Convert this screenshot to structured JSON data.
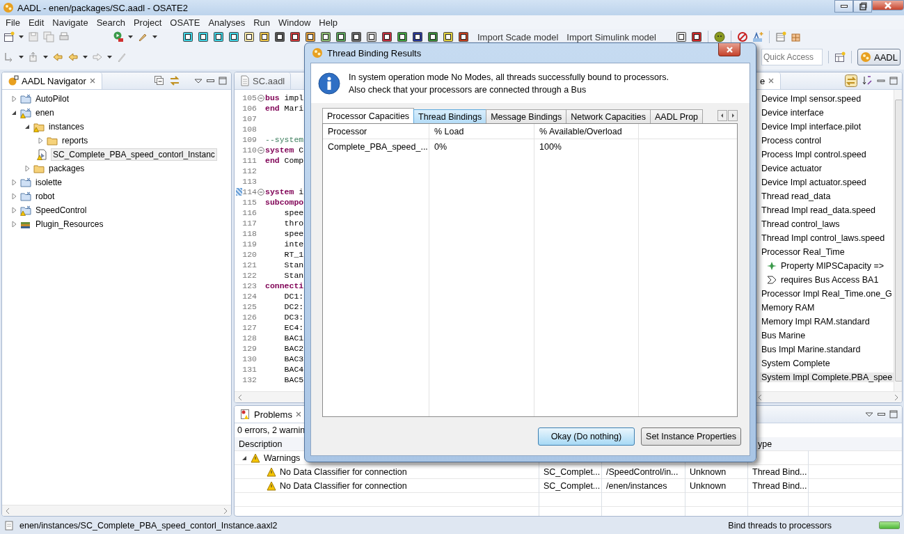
{
  "window": {
    "title": "AADL - enen/packages/SC.aadl - OSATE2"
  },
  "menu": [
    "File",
    "Edit",
    "Navigate",
    "Search",
    "Project",
    "OSATE",
    "Analyses",
    "Run",
    "Window",
    "Help"
  ],
  "toolbar": {
    "links": [
      "Import Scade model",
      "Import Simulink model"
    ],
    "quick_access": {
      "placeholder": "Quick Access"
    },
    "perspective": {
      "label": "AADL",
      "selected": true
    }
  },
  "navigator": {
    "title": "AADL Navigator",
    "items": [
      {
        "label": "AutoPilot",
        "kind": "project",
        "warning": false,
        "expanded": false,
        "selected": false
      },
      {
        "label": "enen",
        "kind": "project",
        "warning": true,
        "expanded": true,
        "selected": false,
        "children": [
          {
            "label": "instances",
            "kind": "folder",
            "warning": true,
            "expanded": true,
            "selected": false,
            "children": [
              {
                "label": "reports",
                "kind": "folder",
                "warning": false,
                "expanded": false,
                "selected": false
              },
              {
                "label": "SC_Complete_PBA_speed_contorl_Instanc",
                "kind": "file",
                "warning": true,
                "selected": true
              }
            ]
          },
          {
            "label": "packages",
            "kind": "folder",
            "warning": false,
            "expanded": false,
            "selected": false
          }
        ]
      },
      {
        "label": "isolette",
        "kind": "project",
        "warning": false,
        "expanded": false,
        "selected": false
      },
      {
        "label": "robot",
        "kind": "project",
        "warning": false,
        "expanded": false,
        "selected": false
      },
      {
        "label": "SpeedControl",
        "kind": "project",
        "warning": true,
        "expanded": false,
        "selected": false
      },
      {
        "label": "Plugin_Resources",
        "kind": "library",
        "warning": false,
        "expanded": false,
        "selected": false
      }
    ]
  },
  "editor": {
    "tab": "SC.aadl",
    "lines": [
      {
        "num": "105",
        "fold": true,
        "marked": false,
        "tokens": [
          {
            "kind": "keyword",
            "text": "bus"
          },
          {
            "kind": "plain",
            "text": " impl"
          }
        ]
      },
      {
        "num": "106",
        "fold": false,
        "marked": false,
        "tokens": [
          {
            "kind": "keyword",
            "text": "end"
          },
          {
            "kind": "plain",
            "text": " Mari"
          }
        ]
      },
      {
        "num": "107",
        "fold": false,
        "marked": false
      },
      {
        "num": "108",
        "fold": false,
        "marked": false
      },
      {
        "num": "109",
        "fold": false,
        "marked": false,
        "tokens": [
          {
            "kind": "comment",
            "text": "--system"
          }
        ]
      },
      {
        "num": "110",
        "fold": true,
        "marked": false,
        "tokens": [
          {
            "kind": "keyword",
            "text": "system"
          },
          {
            "kind": "plain",
            "text": " C"
          }
        ]
      },
      {
        "num": "111",
        "fold": false,
        "marked": false,
        "tokens": [
          {
            "kind": "keyword",
            "text": "end"
          },
          {
            "kind": "plain",
            "text": " Comp"
          }
        ]
      },
      {
        "num": "112",
        "fold": false,
        "marked": false
      },
      {
        "num": "113",
        "fold": false,
        "marked": false
      },
      {
        "num": "114",
        "fold": true,
        "marked": true,
        "tokens": [
          {
            "kind": "keyword",
            "text": "system"
          },
          {
            "kind": "plain",
            "text": " i"
          }
        ]
      },
      {
        "num": "115",
        "fold": false,
        "marked": false,
        "tokens": [
          {
            "kind": "keyword",
            "text": "subcompo"
          }
        ]
      },
      {
        "num": "116",
        "fold": false,
        "marked": false,
        "tokens": [
          {
            "kind": "plain",
            "text": "    spee"
          }
        ]
      },
      {
        "num": "117",
        "fold": false,
        "marked": false,
        "tokens": [
          {
            "kind": "plain",
            "text": "    thro"
          }
        ]
      },
      {
        "num": "118",
        "fold": false,
        "marked": false,
        "tokens": [
          {
            "kind": "plain",
            "text": "    spee"
          }
        ]
      },
      {
        "num": "119",
        "fold": false,
        "marked": false,
        "tokens": [
          {
            "kind": "plain",
            "text": "    inte"
          }
        ]
      },
      {
        "num": "120",
        "fold": false,
        "marked": false,
        "tokens": [
          {
            "kind": "plain",
            "text": "    RT_1"
          }
        ]
      },
      {
        "num": "121",
        "fold": false,
        "marked": false,
        "tokens": [
          {
            "kind": "plain",
            "text": "    Stan"
          }
        ]
      },
      {
        "num": "122",
        "fold": false,
        "marked": false,
        "tokens": [
          {
            "kind": "plain",
            "text": "    Stan"
          }
        ]
      },
      {
        "num": "123",
        "fold": false,
        "marked": false,
        "tokens": [
          {
            "kind": "keyword",
            "text": "connecti"
          }
        ]
      },
      {
        "num": "124",
        "fold": false,
        "marked": false,
        "tokens": [
          {
            "kind": "plain",
            "text": "    DC1:"
          }
        ]
      },
      {
        "num": "125",
        "fold": false,
        "marked": false,
        "tokens": [
          {
            "kind": "plain",
            "text": "    DC2:"
          }
        ]
      },
      {
        "num": "126",
        "fold": false,
        "marked": false,
        "tokens": [
          {
            "kind": "plain",
            "text": "    DC3:"
          }
        ]
      },
      {
        "num": "127",
        "fold": false,
        "marked": false,
        "tokens": [
          {
            "kind": "plain",
            "text": "    EC4:"
          }
        ]
      },
      {
        "num": "128",
        "fold": false,
        "marked": false,
        "tokens": [
          {
            "kind": "plain",
            "text": "    BAC1"
          }
        ]
      },
      {
        "num": "129",
        "fold": false,
        "marked": false,
        "tokens": [
          {
            "kind": "plain",
            "text": "    BAC2"
          }
        ]
      },
      {
        "num": "130",
        "fold": false,
        "marked": false,
        "tokens": [
          {
            "kind": "plain",
            "text": "    BAC3"
          }
        ]
      },
      {
        "num": "131",
        "fold": false,
        "marked": false,
        "tokens": [
          {
            "kind": "plain",
            "text": "    BAC4"
          }
        ]
      },
      {
        "num": "132",
        "fold": false,
        "marked": false,
        "tokens": [
          {
            "kind": "plain",
            "text": "    BAC5"
          }
        ]
      }
    ]
  },
  "outline": {
    "tab": "e",
    "items": [
      {
        "label": "Device Impl sensor.speed",
        "selected": false
      },
      {
        "label": "Device interface",
        "selected": false
      },
      {
        "label": "Device Impl interface.pilot",
        "selected": false
      },
      {
        "label": "Process control",
        "selected": false
      },
      {
        "label": "Process Impl control.speed",
        "selected": false
      },
      {
        "label": "Device actuator",
        "selected": false
      },
      {
        "label": "Device Impl actuator.speed",
        "selected": false
      },
      {
        "label": "Thread read_data",
        "selected": false
      },
      {
        "label": "Thread Impl read_data.speed",
        "selected": false
      },
      {
        "label": "Thread control_laws",
        "selected": false
      },
      {
        "label": "Thread Impl control_laws.speed",
        "selected": false
      },
      {
        "label": "Processor Real_Time",
        "selected": false,
        "children": [
          {
            "label": "Property MIPSCapacity =>",
            "kind": "property",
            "selected": false
          },
          {
            "label": "requires Bus Access BA1",
            "kind": "feature",
            "selected": false
          }
        ]
      },
      {
        "label": "Processor Impl Real_Time.one_G",
        "selected": false
      },
      {
        "label": "Memory RAM",
        "selected": false
      },
      {
        "label": "Memory Impl RAM.standard",
        "selected": false
      },
      {
        "label": "Bus Marine",
        "selected": false
      },
      {
        "label": "Bus Impl Marine.standard",
        "selected": false
      },
      {
        "label": "System Complete",
        "selected": false
      },
      {
        "label": "System Impl Complete.PBA_spee",
        "selected": true
      }
    ]
  },
  "problems": {
    "title": "Problems",
    "summary": "0 errors, 2 warnin",
    "columns": [
      "Description",
      "ype"
    ],
    "groups": [
      {
        "label": "Warnings",
        "expanded": true,
        "rows": [
          {
            "description": "No Data Classifier for connection",
            "column_2": "SC_Complet...",
            "column_3": "/SpeedControl/in...",
            "column_4": "Unknown",
            "column_5": "Thread Bind..."
          },
          {
            "description": "No Data Classifier for connection",
            "column_2": "SC_Complet...",
            "column_3": "/enen/instances",
            "column_4": "Unknown",
            "column_5": "Thread Bind..."
          }
        ]
      }
    ]
  },
  "dialog": {
    "title": "Thread Binding Results",
    "message": [
      "In system operation mode No Modes, all threads successfully bound to processors.",
      "Also check that your processors are connected through a Bus"
    ],
    "tabs": [
      {
        "label": "Processor Capacities",
        "selected": true,
        "hovered": false
      },
      {
        "label": "Thread Bindings",
        "selected": false,
        "hovered": true
      },
      {
        "label": "Message Bindings",
        "selected": false,
        "hovered": false
      },
      {
        "label": "Network Capacities",
        "selected": false,
        "hovered": false
      },
      {
        "label": "AADL Prop",
        "selected": false,
        "hovered": false
      }
    ],
    "table": {
      "columns": [
        "Processor",
        "% Load",
        "% Available/Overload"
      ],
      "rows": [
        [
          "Complete_PBA_speed_...",
          "0%",
          "100%"
        ]
      ]
    },
    "buttons": [
      {
        "label": "Okay (Do nothing)",
        "default": true
      },
      {
        "label": "Set Instance Properties",
        "default": false
      }
    ]
  },
  "status_bar": {
    "path": "enen/instances/SC_Complete_PBA_speed_contorl_Instance.aaxl2",
    "task": "Bind threads to processors",
    "progress": {
      "level": 1
    }
  }
}
